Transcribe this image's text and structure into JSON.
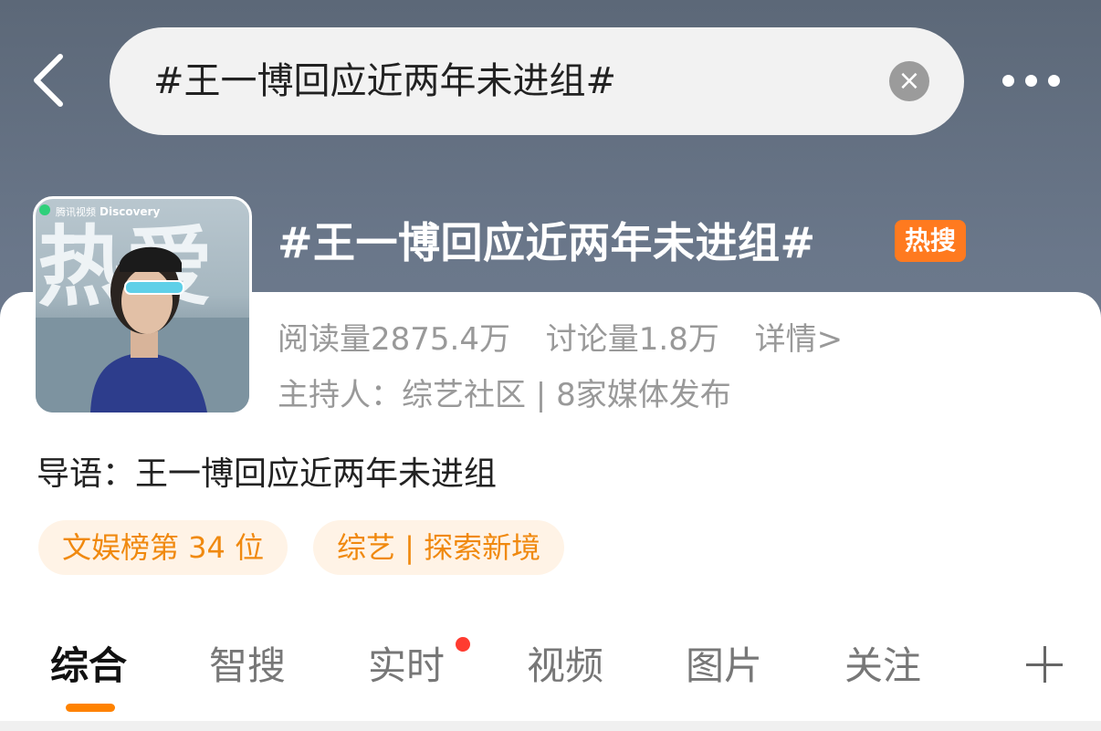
{
  "search": {
    "query": "#王一博回应近两年未进组#"
  },
  "topic": {
    "title": "#王一博回应近两年未进组#",
    "badge": "热搜",
    "reads": "阅读量2875.4万",
    "discussions": "讨论量1.8万",
    "details_link": "详情>",
    "host_line": "主持人：综艺社区 | 8家媒体发布",
    "intro": "导语：王一博回应近两年未进组",
    "tags": [
      "文娱榜第 34 位",
      "综艺 | 探索新境"
    ]
  },
  "cover": {
    "brand_text": "腾讯视频",
    "discovery_text": "Discovery",
    "big_text": "热爱"
  },
  "tabs": [
    {
      "label": "综合",
      "active": true
    },
    {
      "label": "智搜"
    },
    {
      "label": "实时",
      "has_dot": true
    },
    {
      "label": "视频"
    },
    {
      "label": "图片"
    },
    {
      "label": "关注"
    }
  ],
  "colors": {
    "accent": "#ff8200",
    "hot_badge": "#ff7a1f",
    "tag_text": "#f0890f",
    "tag_bg": "#fff3e6",
    "notify_dot": "#ff3b30"
  }
}
